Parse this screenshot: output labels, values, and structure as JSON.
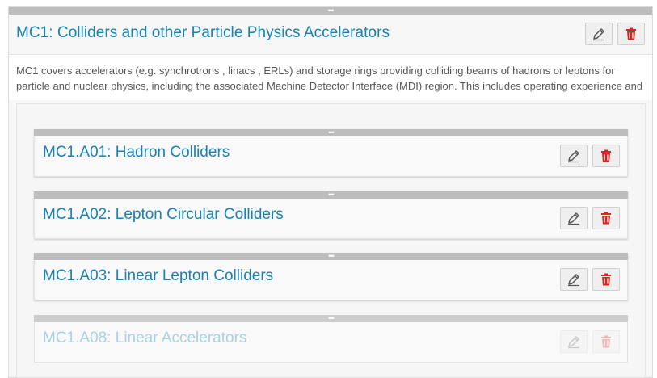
{
  "outer": {
    "title": "MC1: Colliders and other Particle Physics Accelerators",
    "description": "MC1 covers accelerators (e.g. synchrotrons , linacs , ERLs) and storage rings providing colliding beams of hadrons or leptons for particle and nuclear physics, including the associated Machine Detector Interface (MDI) region. This includes operating experience and",
    "drag_handle": "•••",
    "edit_icon": "pencil-icon",
    "delete_icon": "trash-icon"
  },
  "cards": [
    {
      "title": "MC1.A01: Hadron Colliders",
      "drag_handle": "•••",
      "faded": false
    },
    {
      "title": "MC1.A02: Lepton Circular Colliders",
      "drag_handle": "•••",
      "faded": false
    },
    {
      "title": "MC1.A03: Linear Lepton Colliders",
      "drag_handle": "•••",
      "faded": false
    },
    {
      "title": "MC1.A08: Linear Accelerators",
      "drag_handle": "•••",
      "faded": true
    }
  ],
  "colors": {
    "title_blue": "#1a82b0",
    "delete_red": "#d9241f",
    "handle_gray": "#bdbdbd",
    "panel_bg": "#f7f7f7"
  }
}
